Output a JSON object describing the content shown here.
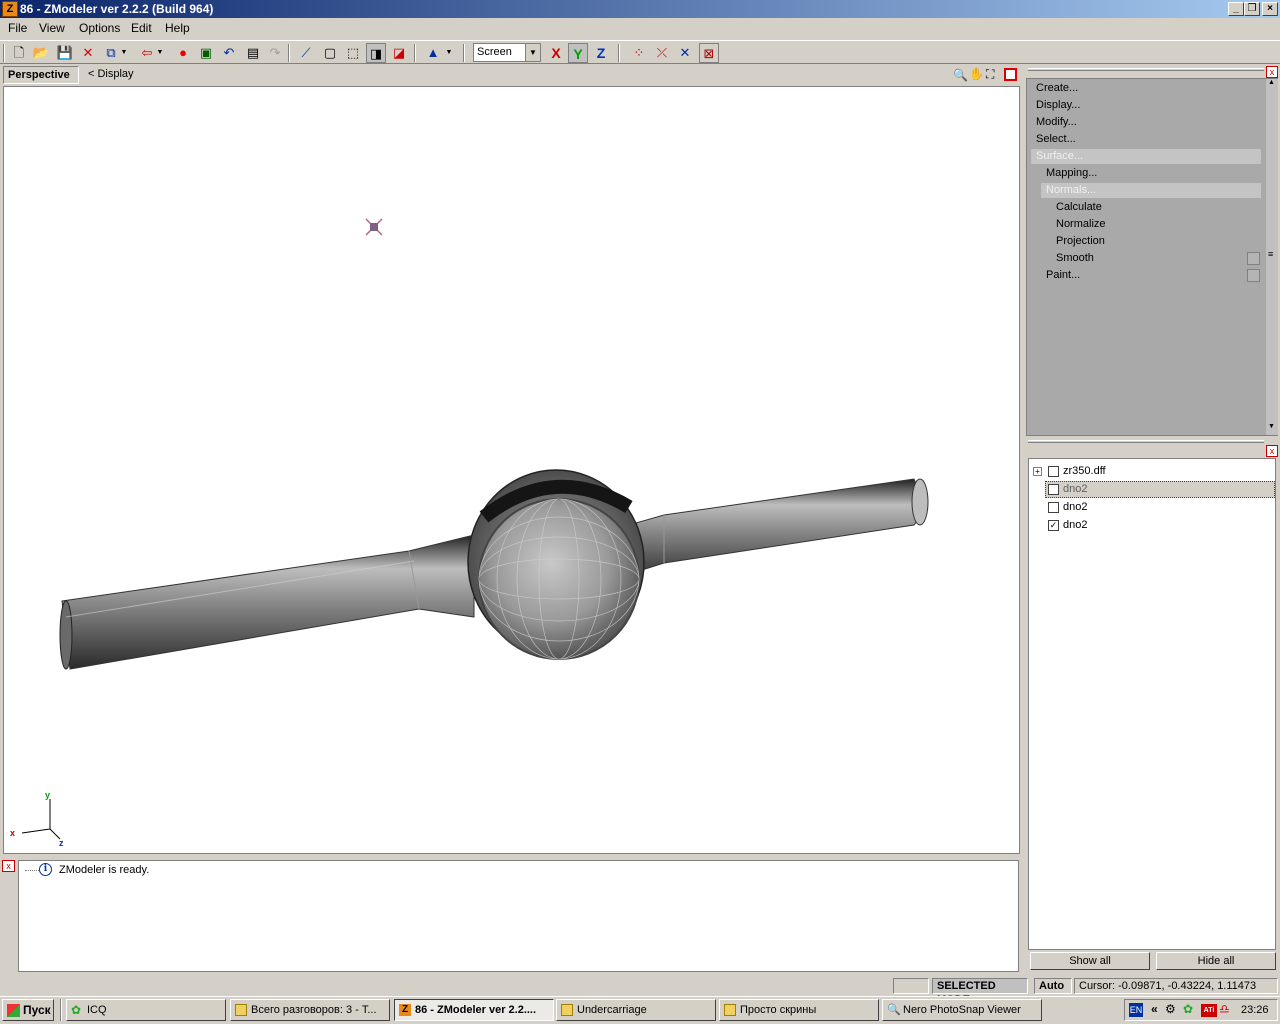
{
  "window": {
    "title": "86 - ZModeler ver 2.2.2 (Build 964)",
    "app_icon": "Z"
  },
  "menu": [
    {
      "label": "File"
    },
    {
      "label": "View"
    },
    {
      "label": "Options"
    },
    {
      "label": "Edit"
    },
    {
      "label": "Help"
    }
  ],
  "toolbar": {
    "mode_select": "Screen",
    "axis_x": "X",
    "axis_y": "Y",
    "axis_z": "Z"
  },
  "viewport": {
    "tab": "Perspective",
    "display_link": "<  Display",
    "axis_y": "y",
    "axis_x": "x",
    "axis_z": "z"
  },
  "log": {
    "message": "ZModeler is ready."
  },
  "command_panel": {
    "items": [
      {
        "label": "Create..."
      },
      {
        "label": "Display..."
      },
      {
        "label": "Modify..."
      },
      {
        "label": "Select..."
      },
      {
        "label": "Surface..."
      },
      {
        "label": "Mapping..."
      },
      {
        "label": "Normals..."
      },
      {
        "label": "Calculate"
      },
      {
        "label": "Normalize"
      },
      {
        "label": "Projection"
      },
      {
        "label": "Smooth"
      },
      {
        "label": "Paint..."
      }
    ]
  },
  "tree": {
    "nodes": [
      {
        "label": "zr350.dff",
        "checked": false
      },
      {
        "label": "dno2",
        "checked": false
      },
      {
        "label": "dno2",
        "checked": false
      },
      {
        "label": "dno2",
        "checked": true
      }
    ],
    "show_all": "Show all",
    "hide_all": "Hide all"
  },
  "status": {
    "mode": "SELECTED MODE",
    "auto": "Auto",
    "cursor": "Cursor: -0.09871, -0.43224, 1.11473"
  },
  "taskbar": {
    "start": "Пуск",
    "tasks": [
      {
        "label": "ICQ"
      },
      {
        "label": "Всего разговоров: 3 - Т..."
      },
      {
        "label": "86 - ZModeler ver 2.2...."
      },
      {
        "label": "Undercarriage"
      },
      {
        "label": "Просто скрины"
      },
      {
        "label": "Nero PhotoSnap Viewer"
      }
    ],
    "lang": "EN",
    "clock": "23:26"
  }
}
